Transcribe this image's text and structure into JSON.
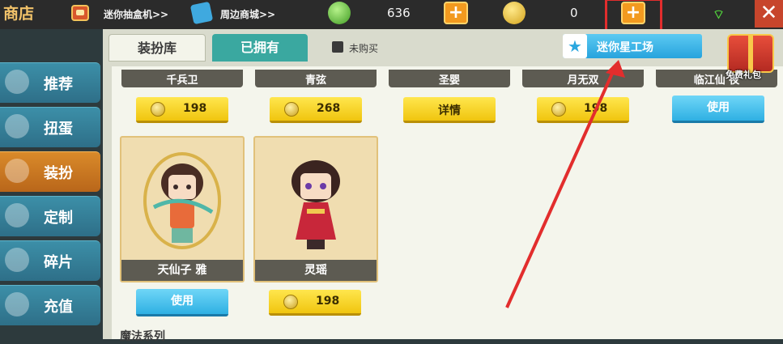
{
  "topbar": {
    "title": "商店",
    "blindbox_link": "迷你抽盒机>>",
    "merch_link": "周边商城>>",
    "gems": "636",
    "coins": "0",
    "plus_label": "+",
    "close_label": "✕",
    "colors": {
      "bar": "#2b2b2b",
      "accent": "#f29a1f",
      "highlight": "#e22d2d"
    }
  },
  "sidebar": {
    "items": [
      {
        "label": "推荐",
        "icon": "thumb-icon"
      },
      {
        "label": "扭蛋",
        "icon": "capsule-icon"
      },
      {
        "label": "装扮",
        "icon": "outfit-icon",
        "active": true
      },
      {
        "label": "定制",
        "icon": "brush-icon"
      },
      {
        "label": "碎片",
        "icon": "puzzle-icon"
      },
      {
        "label": "充值",
        "icon": "coins-icon"
      }
    ]
  },
  "tabs": {
    "wardrobe": "装扮库",
    "owned": "已拥有",
    "not_bought": "未购买"
  },
  "workshop_label": "迷你星工场",
  "gift_label": "免费礼包",
  "top_row": [
    {
      "name": "千兵卫",
      "action": "198",
      "type": "price"
    },
    {
      "name": "青弦",
      "action": "268",
      "type": "price"
    },
    {
      "name": "圣婴",
      "action": "详情",
      "type": "detail"
    },
    {
      "name": "月无双",
      "action": "198",
      "type": "price"
    },
    {
      "name": "临江仙 夜",
      "action": "使用",
      "type": "use"
    }
  ],
  "cards": [
    {
      "name": "天仙子 雅",
      "action": "使用",
      "type": "use"
    },
    {
      "name": "灵瑶",
      "action": "198",
      "type": "price"
    }
  ],
  "section_title": "魔法系列"
}
